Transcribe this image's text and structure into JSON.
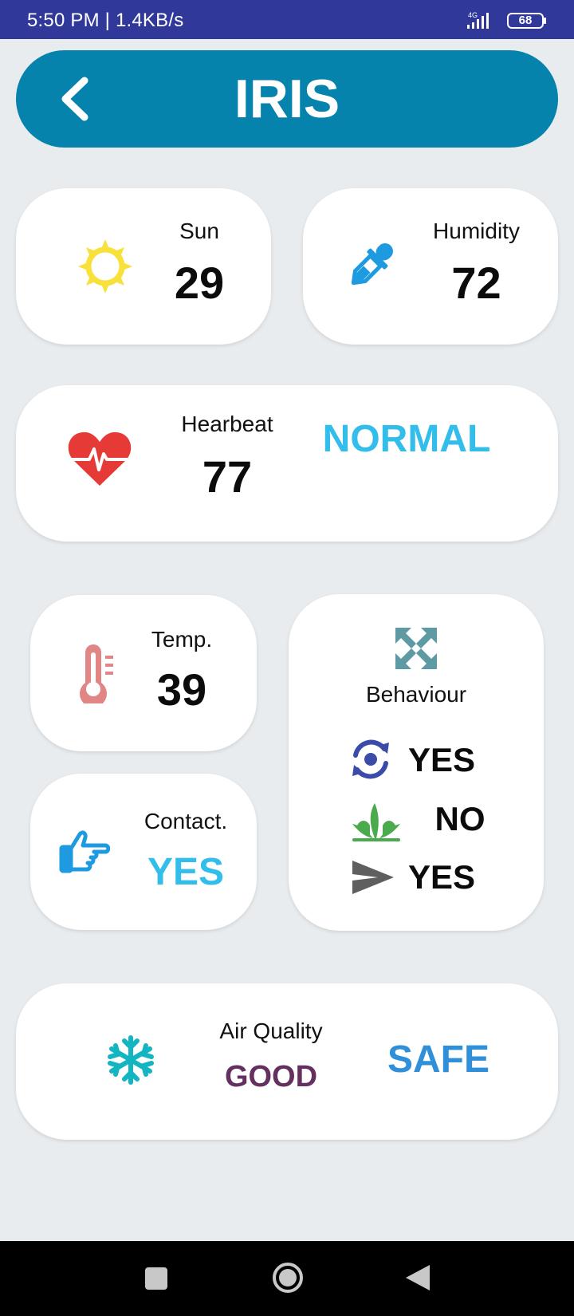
{
  "status_bar": {
    "time_speed": "5:50 PM | 1.4KB/s",
    "network": "4G",
    "battery": "68"
  },
  "header": {
    "title": "IRIS"
  },
  "cards": {
    "sun": {
      "label": "Sun",
      "value": "29"
    },
    "humidity": {
      "label": "Humidity",
      "value": "72"
    },
    "heartbeat": {
      "label": "Hearbeat",
      "value": "77",
      "status": "NORMAL"
    },
    "temp": {
      "label": "Temp.",
      "value": "39"
    },
    "contact": {
      "label": "Contact.",
      "value": "YES"
    },
    "behaviour": {
      "label": "Behaviour",
      "items": [
        {
          "icon": "rotate-icon",
          "value": "YES"
        },
        {
          "icon": "plant-icon",
          "value": "NO"
        },
        {
          "icon": "send-icon",
          "value": "YES"
        }
      ]
    },
    "air_quality": {
      "label": "Air Quality",
      "value": "GOOD",
      "status": "SAFE"
    }
  },
  "icons": {
    "sun": "sun-icon",
    "humidity": "dropper-icon",
    "heartbeat": "heart-pulse-icon",
    "temp": "thermometer-icon",
    "contact": "pointing-hand-icon",
    "behaviour": "expand-arrows-icon",
    "air": "snowflake-icon"
  },
  "colors": {
    "status_bar": "#30399a",
    "header": "#0583ad",
    "background": "#e8ecee",
    "sun": "#f9e13b",
    "dropper": "#1e9be0",
    "heart": "#e53a35",
    "value_blue": "#33bdea",
    "thermometer": "#e18585",
    "contact_hand": "#1e9be0",
    "expand": "#5e9aa3",
    "rotate": "#3a4ca8",
    "plant": "#4caa4e",
    "send": "#5f5f5f",
    "snowflake": "#13b5c0",
    "good": "#633060",
    "safe": "#2f8fd8"
  }
}
